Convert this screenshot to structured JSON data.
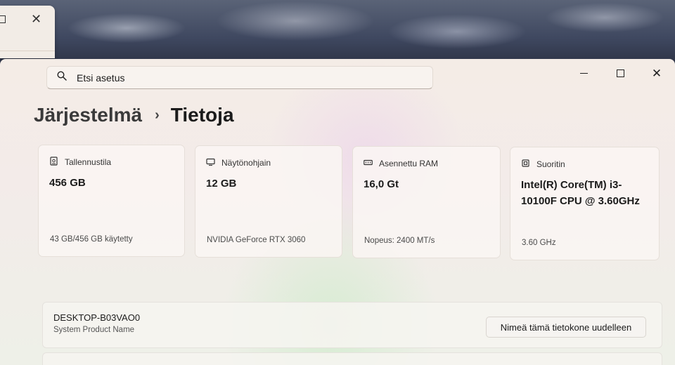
{
  "search": {
    "placeholder": "Etsi asetus"
  },
  "breadcrumb": {
    "parent": "Järjestelmä",
    "separator": "›",
    "current": "Tietoja"
  },
  "specs": [
    {
      "icon": "drive-icon",
      "label": "Tallennustila",
      "value": "456 GB",
      "detail": "43 GB/456 GB käytetty"
    },
    {
      "icon": "monitor-icon",
      "label": "Näytönohjain",
      "value": "12 GB",
      "detail": "NVIDIA GeForce RTX 3060"
    },
    {
      "icon": "memory-icon",
      "label": "Asennettu RAM",
      "value": "16,0 Gt",
      "detail": "Nopeus: 2400 MT/s"
    },
    {
      "icon": "processor-icon",
      "label": "Suoritin",
      "value": "Intel(R) Core(TM) i3-10100F CPU @ 3.60GHz",
      "detail": "3.60 GHz"
    }
  ],
  "device": {
    "name": "DESKTOP-B03VAO0",
    "subtitle": "System Product Name",
    "rename_label": "Nimeä tämä tietokone uudelleen"
  }
}
